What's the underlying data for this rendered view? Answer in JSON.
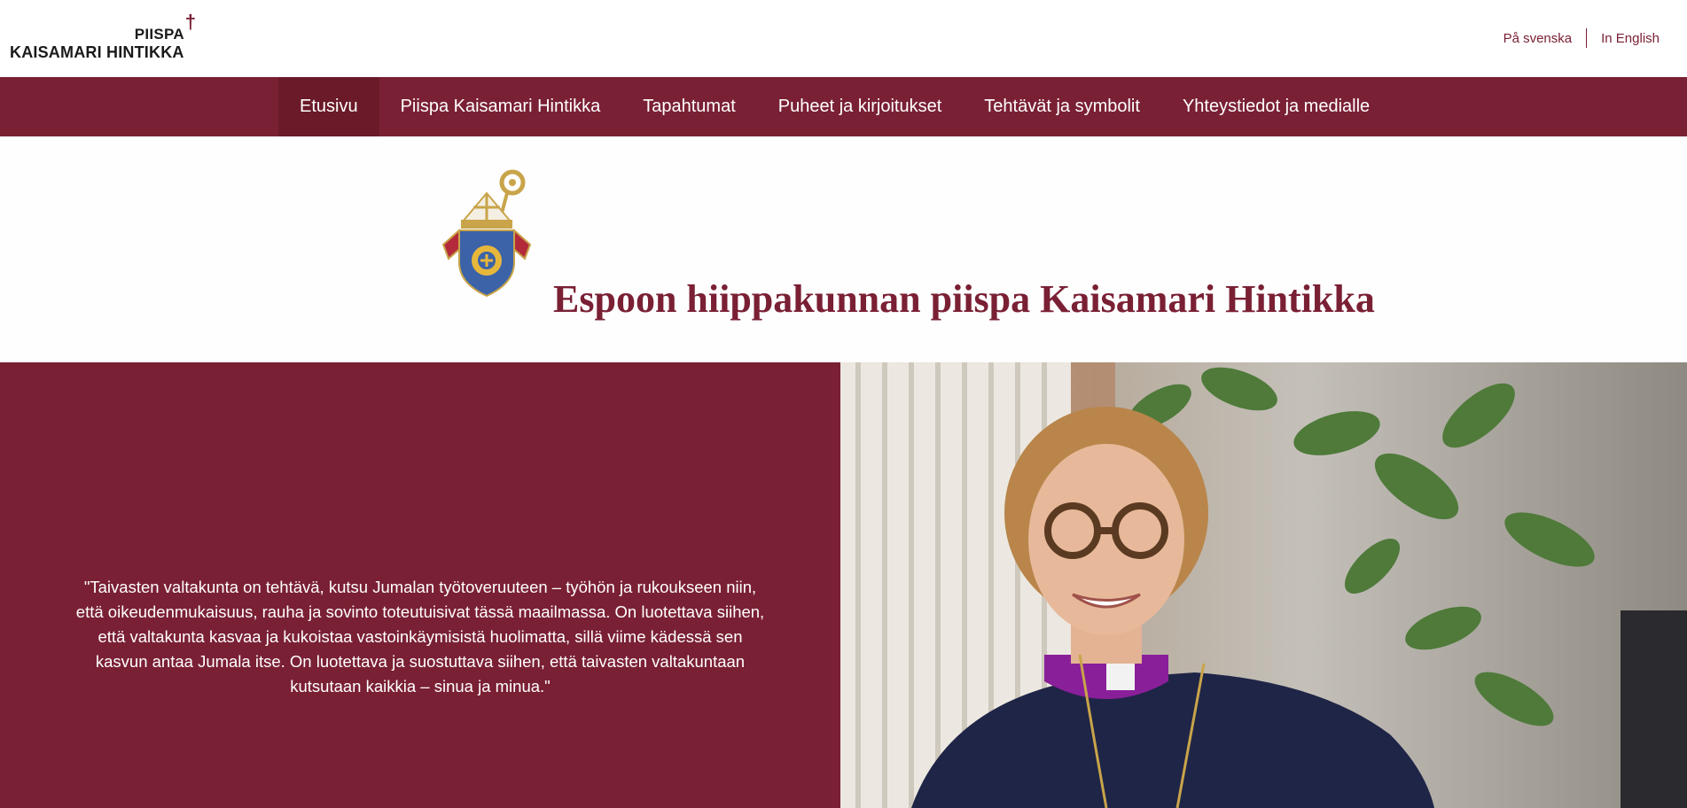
{
  "header": {
    "logo": {
      "line1": "PIISPA",
      "line2": "KAISAMARI HINTIKKA",
      "icon": "cross-icon"
    },
    "languages": [
      {
        "label": "På svenska"
      },
      {
        "label": "In English"
      }
    ]
  },
  "nav": {
    "items": [
      {
        "label": "Etusivu",
        "active": true
      },
      {
        "label": "Piispa Kaisamari Hintikka"
      },
      {
        "label": "Tapahtumat"
      },
      {
        "label": "Puheet ja kirjoitukset"
      },
      {
        "label": "Tehtävät ja symbolit"
      },
      {
        "label": "Yhteystiedot ja medialle"
      }
    ]
  },
  "hero": {
    "crest_icon": "diocese-coat-of-arms-icon",
    "title": "Espoon hiippakunnan piispa Kaisamari Hintikka"
  },
  "quote": {
    "text": "\"Taivasten valtakunta on tehtävä, kutsu Jumalan työtoveruuteen – työhön ja rukoukseen niin, että oikeudenmukaisuus, rauha ja sovinto toteutuisivat tässä maailmassa. On luotettava siihen, että valtakunta kasvaa ja kukoistaa vastoinkäymisistä huolimatta, sillä viime kädessä sen kasvun antaa Jumala itse. On luotettava ja suostuttava siihen, että taivasten valtakuntaan kutsutaan kaikkia – sinua ja minua.\""
  },
  "colors": {
    "brand": "#7a2034",
    "nav_active": "#6a1a28"
  }
}
